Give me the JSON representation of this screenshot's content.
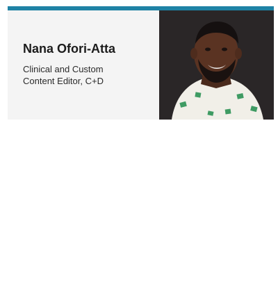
{
  "profile": {
    "name": "Nana Ofori-Atta",
    "title_line1": "Clinical and Custom",
    "title_line2": "Content Editor, C+D"
  },
  "colors": {
    "accent": "#1f82a5",
    "card_background": "#f4f4f4",
    "photo_background": "#2a2627"
  },
  "icons": {
    "photo": "person-portrait-photo"
  }
}
